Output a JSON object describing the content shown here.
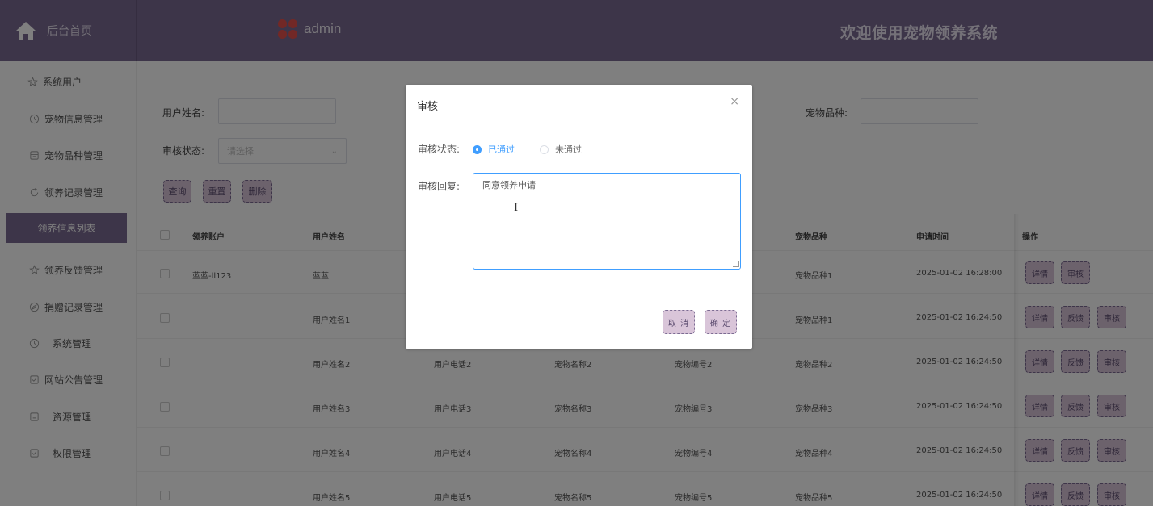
{
  "header": {
    "home_label": "后台首页",
    "logo_text": "admin",
    "welcome": "欢迎使用宠物领养系统",
    "theme_color": "#7b6b92"
  },
  "sidebar": {
    "items": [
      {
        "label": "系统用户",
        "icon": "star-icon"
      },
      {
        "label": "宠物信息管理",
        "icon": "clock-icon"
      },
      {
        "label": "宠物品种管理",
        "icon": "box-icon"
      },
      {
        "label": "领养记录管理",
        "icon": "refresh-icon"
      },
      {
        "label": "领养信息列表",
        "icon": "",
        "active": true
      },
      {
        "label": "领养反馈管理",
        "icon": "star-icon"
      },
      {
        "label": "捐赠记录管理",
        "icon": "compass-icon"
      },
      {
        "label": "系统管理",
        "icon": "clock-icon"
      },
      {
        "label": "网站公告管理",
        "icon": "check-box-icon"
      },
      {
        "label": "资源管理",
        "icon": "box-icon"
      },
      {
        "label": "权限管理",
        "icon": "check-box-icon"
      }
    ]
  },
  "filters": {
    "username_label": "用户姓名:",
    "username_value": "",
    "breed_label": "宠物品种:",
    "breed_value": "",
    "status_label": "审核状态:",
    "status_placeholder": "请选择",
    "query_btn": "查询",
    "reset_btn": "重置",
    "delete_btn": "删除"
  },
  "table": {
    "headers": {
      "account": "领养账户",
      "username": "用户姓名",
      "breed": "宠物品种",
      "time": "申请时间",
      "ops": "操作"
    },
    "rows": [
      {
        "account": "蓝蓝-ll123",
        "username": "蓝蓝",
        "phone": "",
        "petname": "",
        "petno": "",
        "breed": "宠物品种1",
        "time": "2025-01-02 16:28:00"
      },
      {
        "account": "",
        "username": "用户姓名1",
        "phone": "",
        "petname": "",
        "petno": "",
        "breed": "宠物品种1",
        "time": "2025-01-02 16:24:50"
      },
      {
        "account": "",
        "username": "用户姓名2",
        "phone": "用户电话2",
        "petname": "宠物名称2",
        "petno": "宠物编号2",
        "breed": "宠物品种2",
        "time": "2025-01-02 16:24:50"
      },
      {
        "account": "",
        "username": "用户姓名3",
        "phone": "用户电话3",
        "petname": "宠物名称3",
        "petno": "宠物编号3",
        "breed": "宠物品种3",
        "time": "2025-01-02 16:24:50"
      },
      {
        "account": "",
        "username": "用户姓名4",
        "phone": "用户电话4",
        "petname": "宠物名称4",
        "petno": "宠物编号4",
        "breed": "宠物品种4",
        "time": "2025-01-02 16:24:50"
      },
      {
        "account": "",
        "username": "用户姓名5",
        "phone": "用户电话5",
        "petname": "宠物名称5",
        "petno": "宠物编号5",
        "breed": "宠物品种5",
        "time": "2025-01-02 16:24:50"
      }
    ],
    "op_detail": "详情",
    "op_feedback": "反馈",
    "op_review": "审核"
  },
  "dialog": {
    "title": "审核",
    "close": "×",
    "status_label": "审核状态:",
    "radio_pass": "已通过",
    "radio_fail": "未通过",
    "reply_label": "审核回复:",
    "reply_value": "同意领养申请",
    "cancel_btn": "取 消",
    "confirm_btn": "确 定"
  }
}
